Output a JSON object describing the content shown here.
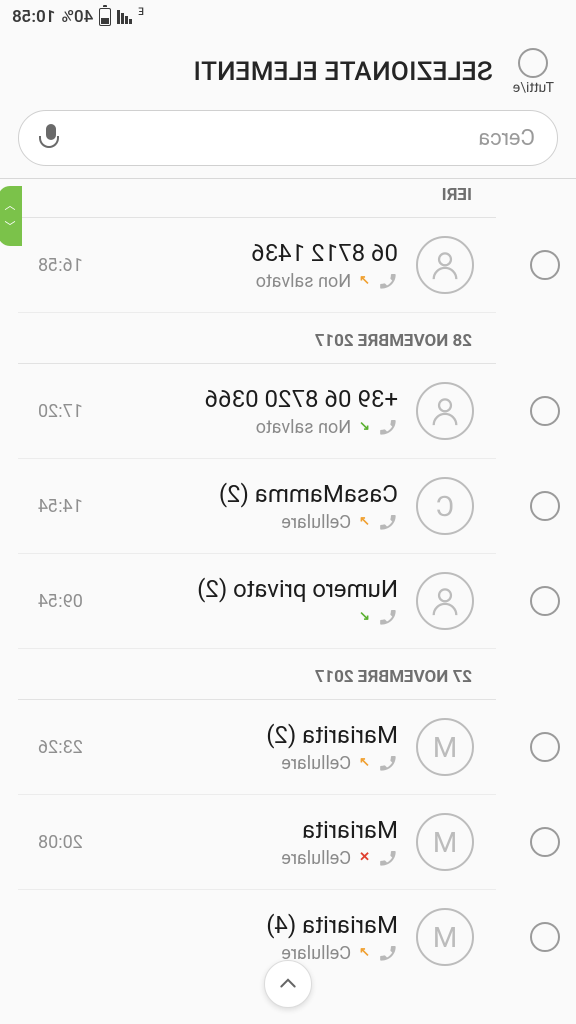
{
  "status": {
    "time": "10:58",
    "battery_pct": "40%",
    "net": "E"
  },
  "header": {
    "select_all_label": "Tutti/e",
    "title": "SELEZIONATE ELEMENTI"
  },
  "search": {
    "placeholder": "Cerca"
  },
  "sections": [
    {
      "label": "IERI",
      "items": [
        {
          "avatar_type": "person",
          "avatar_letter": "",
          "name": "06 8712 1436",
          "call_dir": "out",
          "sub": "Non salvato",
          "time": "16:58"
        }
      ]
    },
    {
      "label": "28 NOVEMBRE 2017",
      "items": [
        {
          "avatar_type": "person",
          "avatar_letter": "",
          "name": "+39 06 8720 0366",
          "call_dir": "in",
          "sub": "Non salvato",
          "time": "17:20"
        },
        {
          "avatar_type": "letter",
          "avatar_letter": "C",
          "name": "CasaMamma (2)",
          "call_dir": "out",
          "sub": "Cellulare",
          "time": "14:54"
        },
        {
          "avatar_type": "person",
          "avatar_letter": "",
          "name": "Numero privato (2)",
          "call_dir": "in",
          "sub": "",
          "time": "09:54"
        }
      ]
    },
    {
      "label": "27 NOVEMBRE 2017",
      "items": [
        {
          "avatar_type": "letter",
          "avatar_letter": "M",
          "name": "Mariarita (2)",
          "call_dir": "out",
          "sub": "Cellulare",
          "time": "23:26"
        },
        {
          "avatar_type": "letter",
          "avatar_letter": "M",
          "name": "Mariarita",
          "call_dir": "miss",
          "sub": "Cellulare",
          "time": "20:08"
        },
        {
          "avatar_type": "letter",
          "avatar_letter": "M",
          "name": "Mariarita (4)",
          "call_dir": "out",
          "sub": "Cellulare",
          "time": ""
        }
      ]
    }
  ]
}
